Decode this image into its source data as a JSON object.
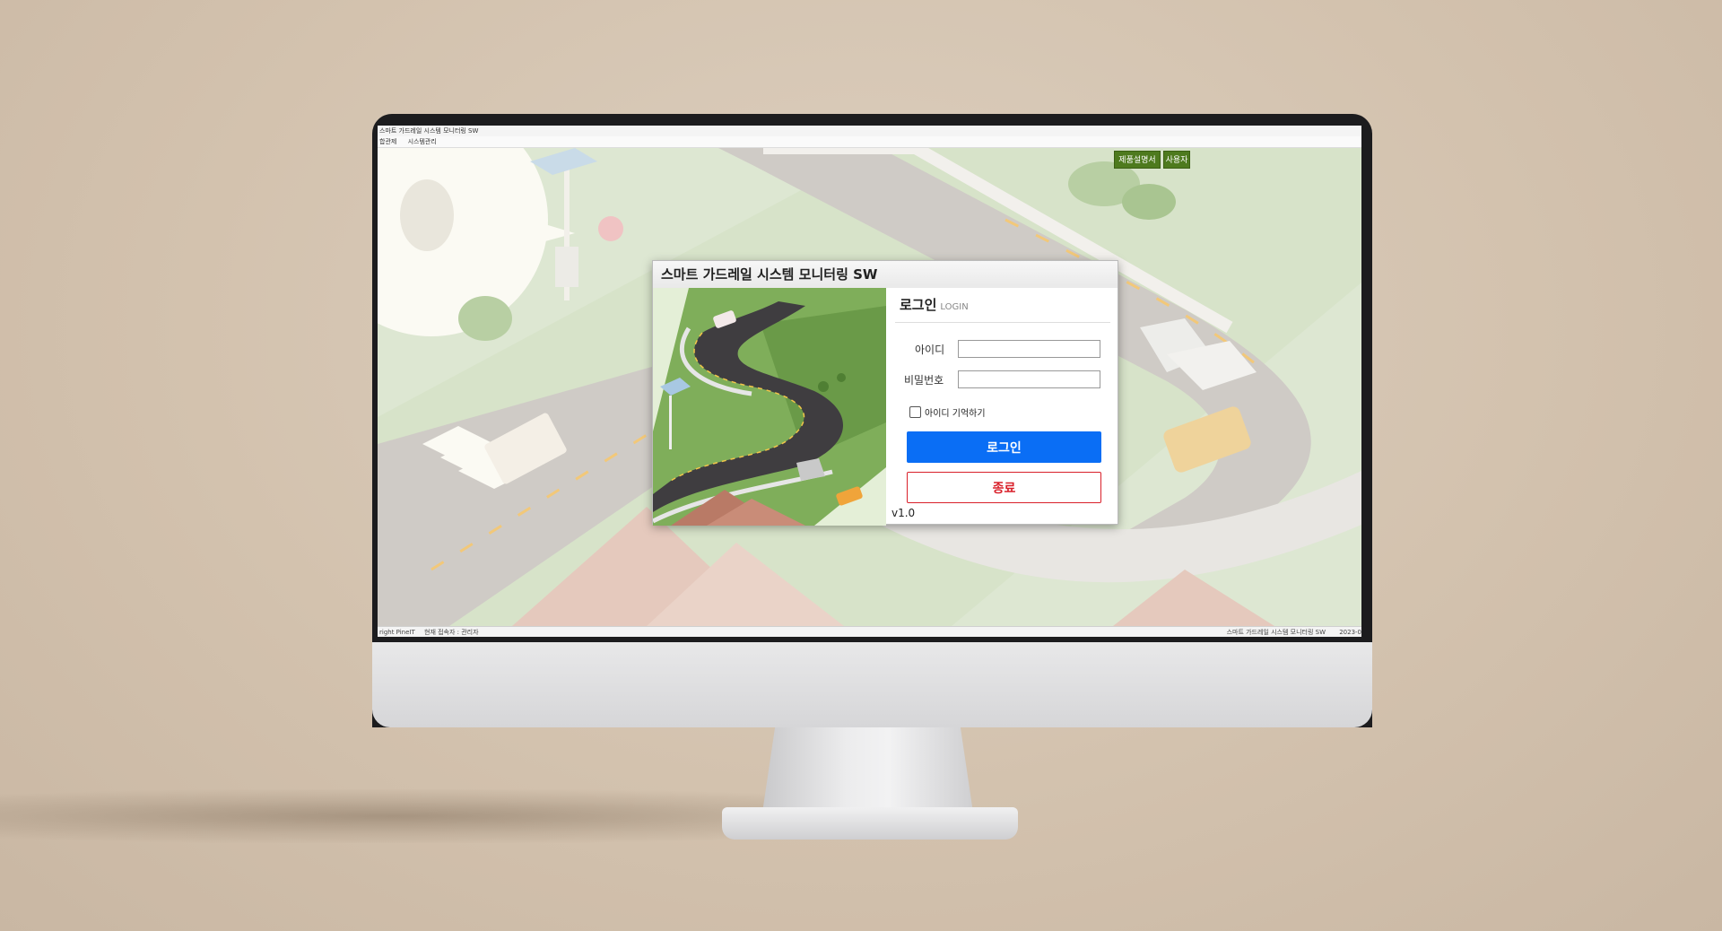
{
  "app": {
    "window_title": "스마트 가드레일 시스템 모니터링 SW",
    "menu": [
      "합관제",
      "시스템관리"
    ],
    "top_buttons": [
      "제품설명서",
      "사용자"
    ],
    "status": {
      "copyright": "right PineIT",
      "current_user": "현재 접속자 : 관리자",
      "app_name": "스마트 가드레일 시스템 모니터링 SW",
      "date": "2023-0"
    }
  },
  "login_dialog": {
    "title": "스마트 가드레일 시스템 모니터링 SW",
    "heading": "로그인",
    "heading_en": "LOGIN",
    "id_label": "아이디",
    "id_value": "",
    "password_label": "비밀번호",
    "password_value": "",
    "remember_label": "아이디 기억하기",
    "remember_checked": false,
    "login_button": "로그인",
    "exit_button": "종료",
    "version": "v1.0"
  },
  "colors": {
    "login_button": "#0a6ef5",
    "exit_button": "#d9202a",
    "green_buttons": "#4e7a1e"
  }
}
